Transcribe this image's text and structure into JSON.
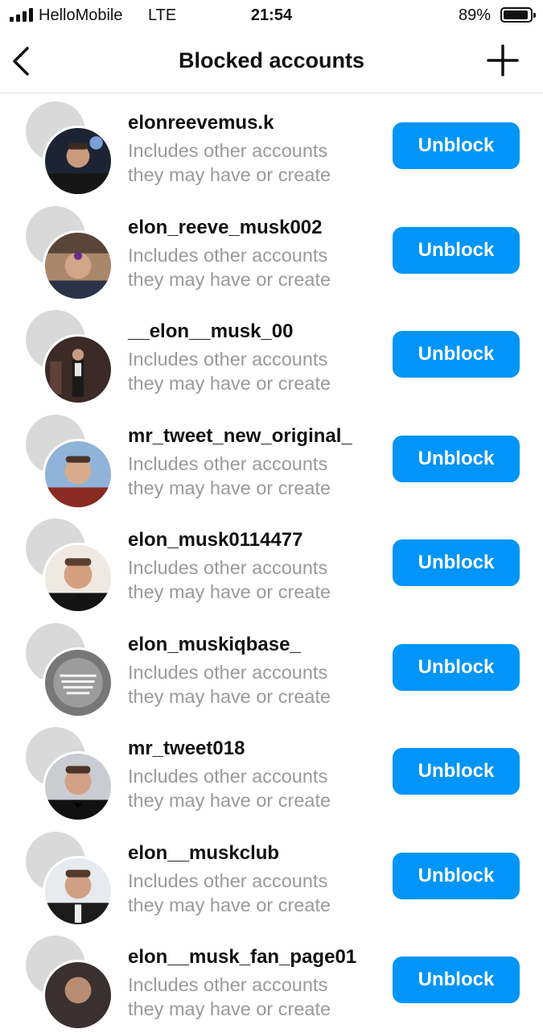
{
  "status_bar": {
    "carrier": "HelloMobile",
    "network": "LTE",
    "time": "21:54",
    "battery_percent": "89%",
    "battery_level": 0.89
  },
  "nav": {
    "title": "Blocked accounts",
    "back_icon": "chevron-left-icon",
    "add_icon": "plus-icon"
  },
  "colors": {
    "accent": "#0095f6",
    "secondary_text": "#9a9a9a",
    "divider": "#dbdbdb"
  },
  "blocked_accounts": [
    {
      "username": "elonreevemus.k",
      "subtext_line1": "Includes other accounts",
      "subtext_line2": "they may have or create",
      "button": "Unblock"
    },
    {
      "username": "elon_reeve_musk002",
      "subtext_line1": "Includes other accounts",
      "subtext_line2": "they may have or create",
      "button": "Unblock"
    },
    {
      "username": "__elon__musk_00",
      "subtext_line1": "Includes other accounts",
      "subtext_line2": "they may have or create",
      "button": "Unblock"
    },
    {
      "username": "mr_tweet_new_original_",
      "subtext_line1": "Includes other accounts",
      "subtext_line2": "they may have or create",
      "button": "Unblock"
    },
    {
      "username": "elon_musk0114477",
      "subtext_line1": "Includes other accounts",
      "subtext_line2": "they may have or create",
      "button": "Unblock"
    },
    {
      "username": "elon_muskiqbase_",
      "subtext_line1": "Includes other accounts",
      "subtext_line2": "they may have or create",
      "button": "Unblock"
    },
    {
      "username": "mr_tweet018",
      "subtext_line1": "Includes other accounts",
      "subtext_line2": "they may have or create",
      "button": "Unblock"
    },
    {
      "username": "elon__muskclub",
      "subtext_line1": "Includes other accounts",
      "subtext_line2": "they may have or create",
      "button": "Unblock"
    },
    {
      "username": "elon__musk_fan_page01",
      "subtext_line1": "Includes other accounts",
      "subtext_line2": "they may have or create",
      "button": "Unblock"
    }
  ]
}
